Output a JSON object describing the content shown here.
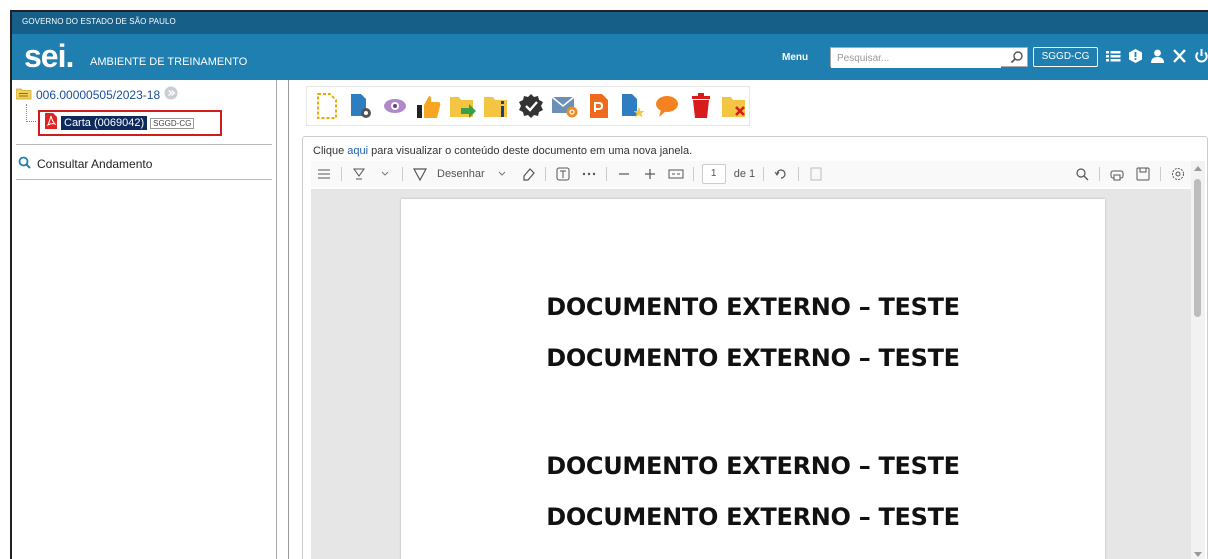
{
  "header": {
    "gov_label": "GOVERNO DO ESTADO DE SÃO PAULO",
    "logo": "sei",
    "logo_dot": ".",
    "environment": "AMBIENTE DE TREINAMENTO",
    "menu_label": "Menu",
    "search_placeholder": "Pesquisar...",
    "unit": "SGGD-CG",
    "icons": [
      "list-icon",
      "info-icon",
      "user-icon",
      "tools-icon",
      "power-icon"
    ]
  },
  "tree": {
    "process_number": "006.00000505/2023-18",
    "document_label": "Carta (0069042)",
    "document_unit": "SGGD-CG",
    "consultar": "Consultar Andamento"
  },
  "toolbar": {
    "icons": [
      "new-document-icon",
      "document-settings-icon",
      "view-icon",
      "thumbs-up-icon",
      "send-process-icon",
      "folder-info-icon",
      "signature-badge-icon",
      "email-icon",
      "pdf-export-icon",
      "document-star-icon",
      "comment-icon",
      "trash-icon",
      "close-folder-icon"
    ]
  },
  "viewer": {
    "hint_prefix": "Clique ",
    "hint_link": "aqui",
    "hint_suffix": " para visualizar o conteúdo deste documento em uma nova janela.",
    "draw_label": "Desenhar",
    "page_number": "1",
    "page_total": "de 1",
    "document_lines": [
      "DOCUMENTO EXTERNO – TESTE",
      "DOCUMENTO EXTERNO – TESTE",
      "DOCUMENTO EXTERNO – TESTE",
      "DOCUMENTO EXTERNO – TESTE"
    ]
  },
  "colors": {
    "gov_bar": "#155f88",
    "top_bar": "#1e7fb0",
    "highlight_border": "#d21c1c",
    "selected_doc": "#0d2a5c"
  }
}
